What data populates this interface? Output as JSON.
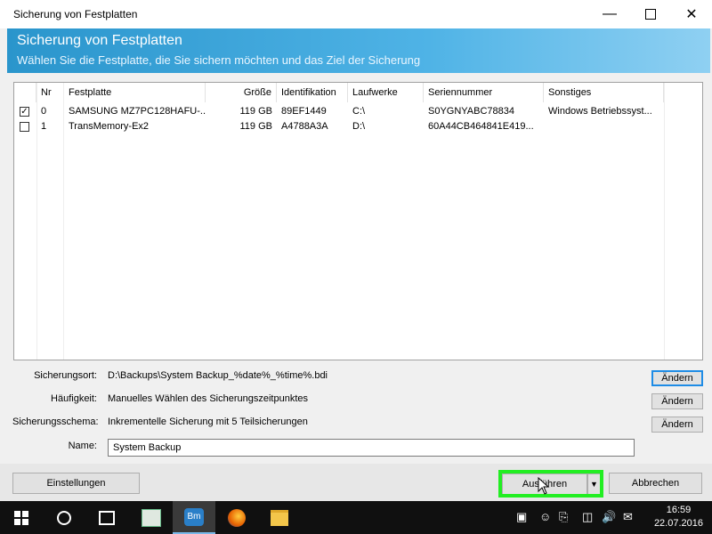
{
  "window": {
    "title": "Sicherung von Festplatten"
  },
  "banner": {
    "title": "Sicherung von Festplatten",
    "subtitle": "Wählen Sie die Festplatte, die Sie sichern möchten und das Ziel der Sicherung"
  },
  "table": {
    "columns": [
      "Nr",
      "Festplatte",
      "Größe",
      "Identifikation",
      "Laufwerke",
      "Seriennummer",
      "Sonstiges"
    ],
    "rows": [
      {
        "checked": true,
        "cells": [
          "0",
          "SAMSUNG MZ7PC128HAFU-...",
          "119 GB",
          "89EF1449",
          "C:\\",
          "S0YGNYABC78834",
          "Windows Betriebssyst..."
        ]
      },
      {
        "checked": false,
        "cells": [
          "1",
          "TransMemory-Ex2",
          "119 GB",
          "A4788A3A",
          "D:\\",
          "60A44CB464841E419...",
          ""
        ]
      }
    ]
  },
  "form": {
    "location_label": "Sicherungsort:",
    "location_value": "D:\\Backups\\System Backup_%date%_%time%.bdi",
    "frequency_label": "Häufigkeit:",
    "frequency_value": "Manuelles Wählen des Sicherungszeitpunktes",
    "schema_label": "Sicherungsschema:",
    "schema_value": "Inkrementelle Sicherung mit 5 Teilsicherungen",
    "name_label": "Name:",
    "name_value": "System Backup",
    "change_label": "Ändern"
  },
  "buttons": {
    "settings": "Einstellungen",
    "run": "Ausführen",
    "cancel": "Abbrechen"
  },
  "taskbar": {
    "time": "16:59",
    "date": "22.07.2016"
  }
}
